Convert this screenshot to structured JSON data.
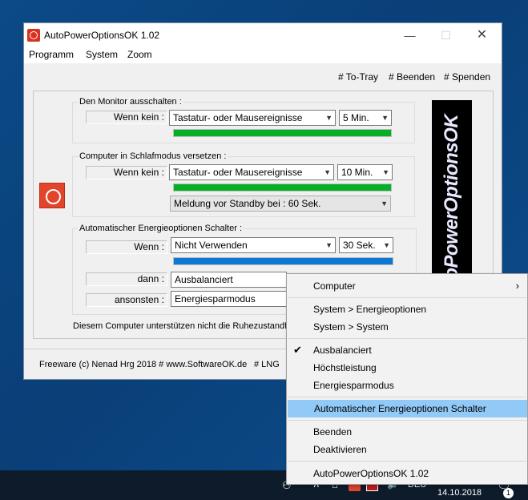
{
  "window": {
    "title": "AutoPowerOptionsOK 1.02",
    "min_glyph": "—",
    "max_glyph": "☐",
    "close_glyph": "✕"
  },
  "menubar": [
    "Programm",
    "System",
    "Zoom"
  ],
  "toplinks": [
    "# To-Tray",
    "# Beenden",
    "# Spenden"
  ],
  "monitor": {
    "group_title": "Den Monitor ausschalten :",
    "label": "Wenn kein :",
    "event": "Tastatur- oder Mausereignisse",
    "time": "5 Min.",
    "progress": 1.0
  },
  "sleep": {
    "group_title": "Computer in Schlafmodus versetzen :",
    "label": "Wenn kein :",
    "event": "Tastatur- oder Mausereignisse",
    "time": "10 Min.",
    "progress": 1.0,
    "warning": "Meldung vor Standby bei : 60 Sek."
  },
  "auto": {
    "group_title": "Automatischer Energieoptionen Schalter :",
    "when_label": "Wenn :",
    "when_value": "Nicht Verwenden",
    "time": "30 Sek.",
    "progress": 1.0,
    "then_label": "dann :",
    "then_value": "Ausbalanciert",
    "else_label": "ansonsten :",
    "else_value": "Energiesparmodus"
  },
  "status_text": "Diesem Computer unterstützen nicht die Ruhezustandfun",
  "footer": {
    "left": "Freeware (c) Nenad Hrg 2018 # www.SoftwareOK.de",
    "lng": "# LNG"
  },
  "logo_text": "AutoPowerOptionsOK",
  "context_menu": {
    "computer": "Computer",
    "energieoptionen": "System > Energieoptionen",
    "system": "System > System",
    "ausbalanciert": "Ausbalanciert",
    "hoechstleistung": "Höchstleistung",
    "energiesparmodus": "Energiesparmodus",
    "auto_switch": "Automatischer Energieoptionen Schalter",
    "beenden": "Beenden",
    "deaktivieren": "Deaktivieren",
    "version": "AutoPowerOptionsOK 1.02"
  },
  "taskbar": {
    "lang": "DEU",
    "date": "14.10.2018",
    "notification_count": "1"
  },
  "colors": {
    "progress_green": "#06b025",
    "progress_blue": "#0a78d4",
    "highlight": "#91c9f7"
  }
}
